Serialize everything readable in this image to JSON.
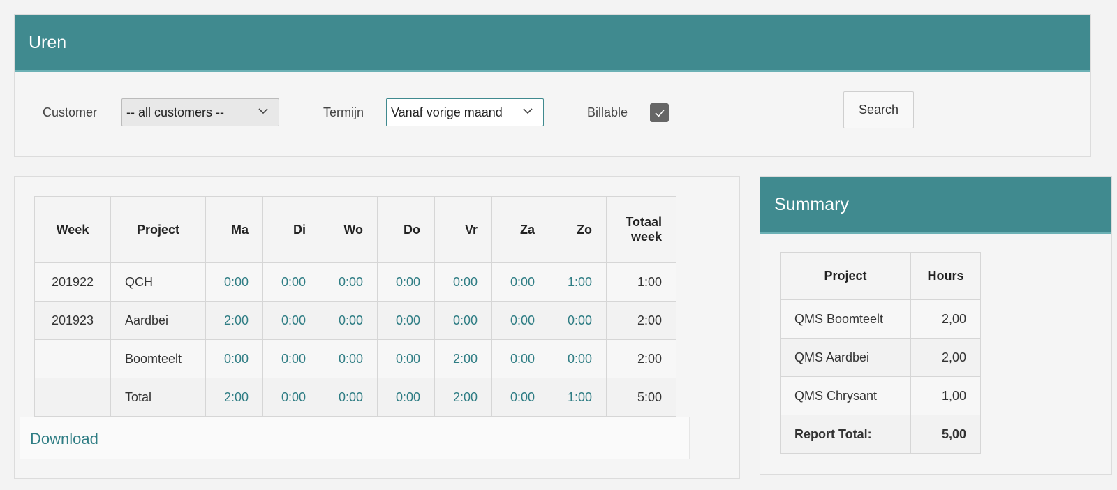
{
  "header": {
    "title": "Uren"
  },
  "filters": {
    "customer_label": "Customer",
    "customer_value": "-- all customers --",
    "termijn_label": "Termijn",
    "termijn_value": "Vanaf vorige maand",
    "billable_label": "Billable",
    "billable_checked": true,
    "search_label": "Search"
  },
  "report": {
    "columns": [
      "Week",
      "Project",
      "Ma",
      "Di",
      "Wo",
      "Do",
      "Vr",
      "Za",
      "Zo",
      "Totaal week"
    ],
    "total_week_label_line1": "Totaal",
    "total_week_label_line2": "week",
    "rows": [
      {
        "week": "201922",
        "project": "QCH",
        "days": [
          "0:00",
          "0:00",
          "0:00",
          "0:00",
          "0:00",
          "0:00",
          "1:00"
        ],
        "total": "1:00"
      },
      {
        "week": "201923",
        "project": "Aardbei",
        "days": [
          "2:00",
          "0:00",
          "0:00",
          "0:00",
          "0:00",
          "0:00",
          "0:00"
        ],
        "total": "2:00"
      },
      {
        "week": "",
        "project": "Boomteelt",
        "days": [
          "0:00",
          "0:00",
          "0:00",
          "0:00",
          "2:00",
          "0:00",
          "0:00"
        ],
        "total": "2:00"
      },
      {
        "week": "",
        "project": "Total",
        "days": [
          "2:00",
          "0:00",
          "0:00",
          "0:00",
          "2:00",
          "0:00",
          "1:00"
        ],
        "total": "5:00"
      }
    ],
    "download_label": "Download"
  },
  "summary": {
    "title": "Summary",
    "columns": [
      "Project",
      "Hours"
    ],
    "rows": [
      {
        "project": "QMS Boomteelt",
        "hours": "2,00"
      },
      {
        "project": "QMS Aardbei",
        "hours": "2,00"
      },
      {
        "project": "QMS Chrysant",
        "hours": "1,00"
      }
    ],
    "total_label": "Report Total:",
    "total_value": "5,00"
  },
  "colors": {
    "accent": "#408a8f",
    "link": "#2f7d84"
  }
}
